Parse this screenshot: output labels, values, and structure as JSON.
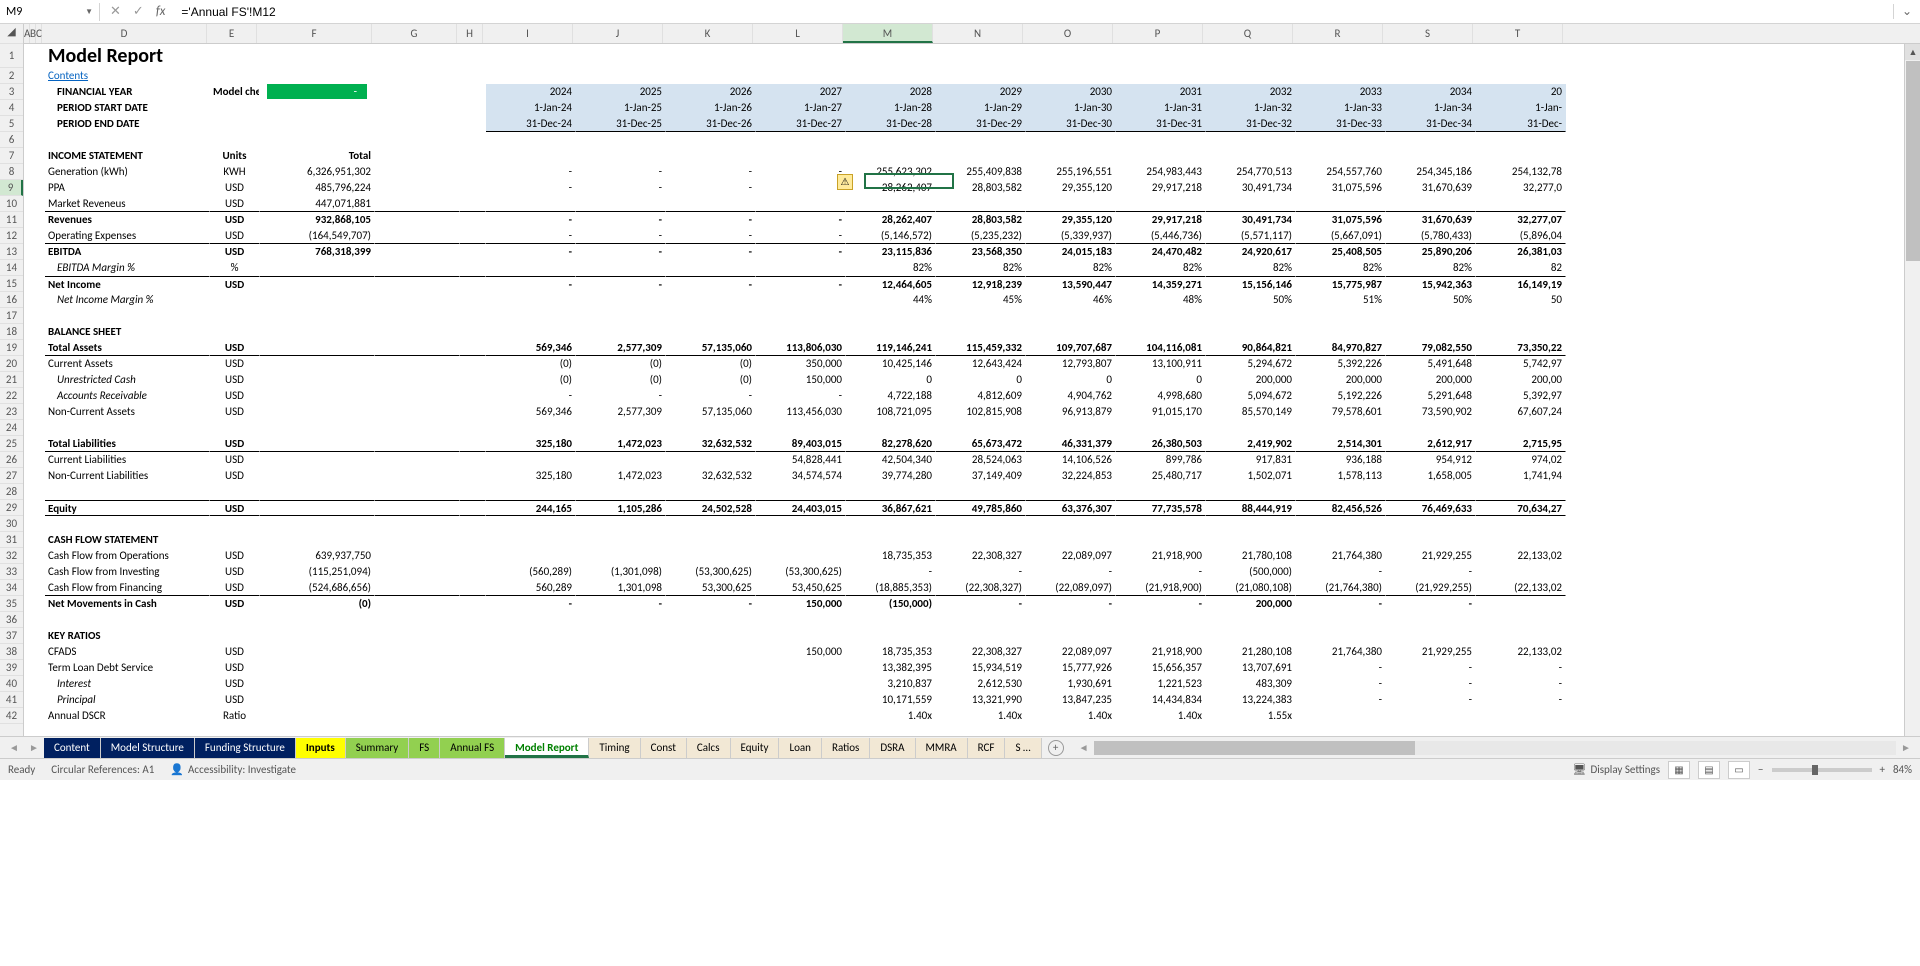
{
  "name_box": "M9",
  "formula": "='Annual FS'!M12",
  "title": "Model Report",
  "contents_link": "Contents",
  "header_labels": {
    "fy": "FINANCIAL YEAR",
    "psd": "PERIOD START DATE",
    "ped": "PERIOD END DATE",
    "mc": "Model checks",
    "mc_val": "-"
  },
  "years": [
    "2024",
    "2025",
    "2026",
    "2027",
    "2028",
    "2029",
    "2030",
    "2031",
    "2032",
    "2033",
    "2034",
    "20"
  ],
  "starts": [
    "1-Jan-24",
    "1-Jan-25",
    "1-Jan-26",
    "1-Jan-27",
    "1-Jan-28",
    "1-Jan-29",
    "1-Jan-30",
    "1-Jan-31",
    "1-Jan-32",
    "1-Jan-33",
    "1-Jan-34",
    "1-Jan-"
  ],
  "ends": [
    "31-Dec-24",
    "31-Dec-25",
    "31-Dec-26",
    "31-Dec-27",
    "31-Dec-28",
    "31-Dec-29",
    "31-Dec-30",
    "31-Dec-31",
    "31-Dec-32",
    "31-Dec-33",
    "31-Dec-34",
    "31-Dec-"
  ],
  "units_col": "Units",
  "total_col": "Total",
  "sections": {
    "income": "INCOME STATEMENT",
    "balance": "BALANCE SHEET",
    "cashflow": "CASH FLOW STATEMENT",
    "ratios": "KEY RATIOS"
  },
  "rows": {
    "gen": {
      "label": "Generation (kWh)",
      "unit": "KWH",
      "total": "6,326,951,302",
      "vals": [
        "-",
        "-",
        "-",
        "-",
        "255,623,302",
        "255,409,838",
        "255,196,551",
        "254,983,443",
        "254,770,513",
        "254,557,760",
        "254,345,186",
        "254,132,78"
      ]
    },
    "ppa": {
      "label": "PPA",
      "unit": "USD",
      "total": "485,796,224",
      "vals": [
        "-",
        "-",
        "-",
        "-",
        "28,262,407",
        "28,803,582",
        "29,355,120",
        "29,917,218",
        "30,491,734",
        "31,075,596",
        "31,670,639",
        "32,277,0"
      ]
    },
    "mrev": {
      "label": "Market Reveneus",
      "unit": "USD",
      "total": "447,071,881",
      "vals": [
        "",
        "",
        "",
        "",
        "",
        "",
        "",
        "",
        "",
        "",
        "",
        ""
      ]
    },
    "rev": {
      "label": "Revenues",
      "unit": "USD",
      "total": "932,868,105",
      "vals": [
        "-",
        "-",
        "-",
        "-",
        "28,262,407",
        "28,803,582",
        "29,355,120",
        "29,917,218",
        "30,491,734",
        "31,075,596",
        "31,670,639",
        "32,277,07"
      ]
    },
    "opex": {
      "label": "Operating Expenses",
      "unit": "USD",
      "total": "(164,549,707)",
      "vals": [
        "-",
        "-",
        "-",
        "-",
        "(5,146,572)",
        "(5,235,232)",
        "(5,339,937)",
        "(5,446,736)",
        "(5,571,117)",
        "(5,667,091)",
        "(5,780,433)",
        "(5,896,04"
      ]
    },
    "ebitda": {
      "label": "EBITDA",
      "unit": "USD",
      "total": "768,318,399",
      "vals": [
        "-",
        "-",
        "-",
        "-",
        "23,115,836",
        "23,568,350",
        "24,015,183",
        "24,470,482",
        "24,920,617",
        "25,408,505",
        "25,890,206",
        "26,381,03"
      ]
    },
    "ebm": {
      "label": "EBITDA Margin %",
      "unit": "%",
      "total": "",
      "vals": [
        "",
        "",
        "",
        "",
        "82%",
        "82%",
        "82%",
        "82%",
        "82%",
        "82%",
        "82%",
        "82"
      ]
    },
    "ni": {
      "label": "Net Income",
      "unit": "USD",
      "total": "",
      "vals": [
        "-",
        "-",
        "-",
        "-",
        "12,464,605",
        "12,918,239",
        "13,590,447",
        "14,359,271",
        "15,156,146",
        "15,775,987",
        "15,942,363",
        "16,149,19"
      ]
    },
    "nim": {
      "label": "Net Income Margin %",
      "unit": "",
      "total": "",
      "vals": [
        "",
        "",
        "",
        "",
        "44%",
        "45%",
        "46%",
        "48%",
        "50%",
        "51%",
        "50%",
        "50"
      ]
    },
    "ta": {
      "label": "Total Assets",
      "unit": "USD",
      "total": "",
      "vals": [
        "569,346",
        "2,577,309",
        "57,135,060",
        "113,806,030",
        "119,146,241",
        "115,459,332",
        "109,707,687",
        "104,116,081",
        "90,864,821",
        "84,970,827",
        "79,082,550",
        "73,350,22"
      ]
    },
    "ca": {
      "label": "Current Assets",
      "unit": "USD",
      "total": "",
      "vals": [
        "(0)",
        "(0)",
        "(0)",
        "350,000",
        "10,425,146",
        "12,643,424",
        "12,793,807",
        "13,100,911",
        "5,294,672",
        "5,392,226",
        "5,491,648",
        "5,742,97"
      ]
    },
    "uc": {
      "label": "Unrestricted Cash",
      "unit": "USD",
      "total": "",
      "vals": [
        "(0)",
        "(0)",
        "(0)",
        "150,000",
        "0",
        "0",
        "0",
        "0",
        "200,000",
        "200,000",
        "200,000",
        "200,00"
      ]
    },
    "ar": {
      "label": "Accounts Receivable",
      "unit": "USD",
      "total": "",
      "vals": [
        "-",
        "-",
        "-",
        "-",
        "4,722,188",
        "4,812,609",
        "4,904,762",
        "4,998,680",
        "5,094,672",
        "5,192,226",
        "5,291,648",
        "5,392,97"
      ]
    },
    "nca": {
      "label": "Non-Current Assets",
      "unit": "USD",
      "total": "",
      "vals": [
        "569,346",
        "2,577,309",
        "57,135,060",
        "113,456,030",
        "108,721,095",
        "102,815,908",
        "96,913,879",
        "91,015,170",
        "85,570,149",
        "79,578,601",
        "73,590,902",
        "67,607,24"
      ]
    },
    "tl": {
      "label": "Total Liabilities",
      "unit": "USD",
      "total": "",
      "vals": [
        "325,180",
        "1,472,023",
        "32,632,532",
        "89,403,015",
        "82,278,620",
        "65,673,472",
        "46,331,379",
        "26,380,503",
        "2,419,902",
        "2,514,301",
        "2,612,917",
        "2,715,95"
      ]
    },
    "cl": {
      "label": "Current Liabilities",
      "unit": "USD",
      "total": "",
      "vals": [
        "",
        "",
        "",
        "54,828,441",
        "42,504,340",
        "28,524,063",
        "14,106,526",
        "899,786",
        "917,831",
        "936,188",
        "954,912",
        "974,02"
      ]
    },
    "ncl": {
      "label": "Non-Current Liabilities",
      "unit": "USD",
      "total": "",
      "vals": [
        "325,180",
        "1,472,023",
        "32,632,532",
        "34,574,574",
        "39,774,280",
        "37,149,409",
        "32,224,853",
        "25,480,717",
        "1,502,071",
        "1,578,113",
        "1,658,005",
        "1,741,94"
      ]
    },
    "eq": {
      "label": "Equity",
      "unit": "USD",
      "total": "",
      "vals": [
        "244,165",
        "1,105,286",
        "24,502,528",
        "24,403,015",
        "36,867,621",
        "49,785,860",
        "63,376,307",
        "77,735,578",
        "88,444,919",
        "82,456,526",
        "76,469,633",
        "70,634,27"
      ]
    },
    "cfo": {
      "label": "Cash Flow from Operations",
      "unit": "USD",
      "total": "639,937,750",
      "vals": [
        "",
        "",
        "",
        "",
        "18,735,353",
        "22,308,327",
        "22,089,097",
        "21,918,900",
        "21,780,108",
        "21,764,380",
        "21,929,255",
        "22,133,02"
      ]
    },
    "cfi": {
      "label": "Cash Flow from Investing",
      "unit": "USD",
      "total": "(115,251,094)",
      "vals": [
        "(560,289)",
        "(1,301,098)",
        "(53,300,625)",
        "(53,300,625)",
        "-",
        "-",
        "-",
        "-",
        "(500,000)",
        "-",
        "-",
        ""
      ]
    },
    "cff": {
      "label": "Cash Flow from Financing",
      "unit": "USD",
      "total": "(524,686,656)",
      "vals": [
        "560,289",
        "1,301,098",
        "53,300,625",
        "53,450,625",
        "(18,885,353)",
        "(22,308,327)",
        "(22,089,097)",
        "(21,918,900)",
        "(21,080,108)",
        "(21,764,380)",
        "(21,929,255)",
        "(22,133,02"
      ]
    },
    "nmc": {
      "label": "Net Movements in Cash",
      "unit": "USD",
      "total": "(0)",
      "vals": [
        "-",
        "-",
        "-",
        "150,000",
        "(150,000)",
        "-",
        "-",
        "-",
        "200,000",
        "-",
        "-",
        ""
      ]
    },
    "cfads": {
      "label": "CFADS",
      "unit": "USD",
      "total": "",
      "vals": [
        "",
        "",
        "",
        "150,000",
        "18,735,353",
        "22,308,327",
        "22,089,097",
        "21,918,900",
        "21,280,108",
        "21,764,380",
        "21,929,255",
        "22,133,02"
      ]
    },
    "tlds": {
      "label": "Term Loan Debt Service",
      "unit": "USD",
      "total": "",
      "vals": [
        "",
        "",
        "",
        "",
        "13,382,395",
        "15,934,519",
        "15,777,926",
        "15,656,357",
        "13,707,691",
        "-",
        "-",
        "-"
      ]
    },
    "int": {
      "label": "Interest",
      "unit": "USD",
      "total": "",
      "vals": [
        "",
        "",
        "",
        "",
        "3,210,837",
        "2,612,530",
        "1,930,691",
        "1,221,523",
        "483,309",
        "-",
        "-",
        "-"
      ]
    },
    "prin": {
      "label": "Principal",
      "unit": "USD",
      "total": "",
      "vals": [
        "",
        "",
        "",
        "",
        "10,171,559",
        "13,321,990",
        "13,847,235",
        "14,434,834",
        "13,224,383",
        "-",
        "-",
        "-"
      ]
    },
    "dscr": {
      "label": "Annual DSCR",
      "unit": "Ratio",
      "total": "",
      "vals": [
        "",
        "",
        "",
        "",
        "1.40x",
        "1.40x",
        "1.40x",
        "1.40x",
        "1.55x",
        "",
        "",
        ""
      ]
    }
  },
  "sheets": [
    "Content",
    "Model Structure",
    "Funding Structure",
    "Inputs",
    "Summary",
    "FS",
    "Annual FS",
    "Model Report",
    "Timing",
    "Const",
    "Calcs",
    "Equity",
    "Loan",
    "Ratios",
    "DSRA",
    "MMRA",
    "RCF",
    "S …"
  ],
  "status": {
    "ready": "Ready",
    "circ": "Circular References: A1",
    "acc": "Accessibility: Investigate",
    "disp": "Display Settings",
    "zoom": "84%"
  }
}
